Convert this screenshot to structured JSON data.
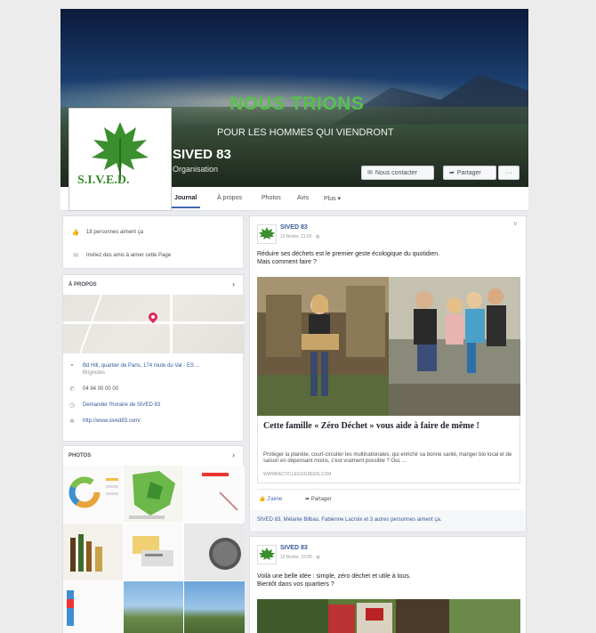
{
  "cover": {
    "slogan": "NOUS TRIONS",
    "subslogan": "POUR LES HOMMES QUI VIENDRONT"
  },
  "profile": {
    "logo_text": "S.I.V.E.D.",
    "name": "SIVED 83",
    "category": "Organisation"
  },
  "buttons": {
    "contact": "Nous contacter",
    "share": "Partager",
    "more": "···"
  },
  "tabs": [
    "Journal",
    "À propos",
    "Photos",
    "Avis",
    "Plus ▾"
  ],
  "active_tab": "Journal",
  "intro": {
    "likes": "18 personnes aiment ça",
    "invite": "Invitez des amis à aimer cette Page"
  },
  "about": {
    "title": "À PROPOS",
    "address": "Bd Hill, quartier de Paris, 174 route du Val - ES ...",
    "city": "Brignoles",
    "phone": "04 94 00 00 00",
    "hours_link": "Demander l'horaire de SIVED 83",
    "website": "http://www.sived83.com/"
  },
  "photos_section": {
    "title": "PHOTOS"
  },
  "post1": {
    "author": "SIVED 83",
    "time": "12 février, 11:02 · ",
    "text_line1": "Réduire ses déchets est le premier geste écologique du quotidien.",
    "text_line2": "Mais comment faire ?",
    "link_title": "Cette famille « Zéro Déchet » vous aide à faire de même !",
    "link_desc": "Protéger la planète, court-circuiter les multinationales, qui enrichir sa bonne santé, manger bio local et de saison en dépensant moins, c'est vraiment possible ? Oui, ...",
    "link_domain": "WWWRECYCLEGOGREEN.COM",
    "like_label": "J'aime",
    "share_label": "Partager",
    "likes_line": "SIVED 83, Mélanie Bilbao, Fabienne Lacroix et 3 autres personnes aiment ça."
  },
  "post2": {
    "author": "SIVED 83",
    "time": "12 février, 15:05 · ",
    "text_line1": "Voilà une belle idée : simple, zéro déchet et utile à tous.",
    "text_line2": "Bientôt dans vos quartiers ?"
  },
  "colors": {
    "brand_green": "#57c04a",
    "facebook_blue": "#4267b2",
    "link_blue": "#365899"
  }
}
